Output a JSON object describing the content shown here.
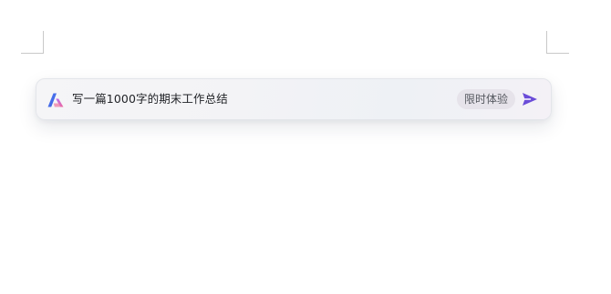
{
  "page": {
    "background": "#ffffff",
    "corner_mark_color": "#c8c8c8"
  },
  "ai_bar": {
    "logo_icon": "ai-assistant-logo-icon",
    "prompt_text": "写一篇1000字的期末工作总结",
    "badge_label": "限时体验",
    "send_icon": "send-arrow-icon",
    "colors": {
      "logo_blue": "#3b6df0",
      "logo_pink": "#f06a9c",
      "send": "#6a4cd8",
      "badge_bg": "#e6e3ea",
      "text": "#222428"
    }
  }
}
